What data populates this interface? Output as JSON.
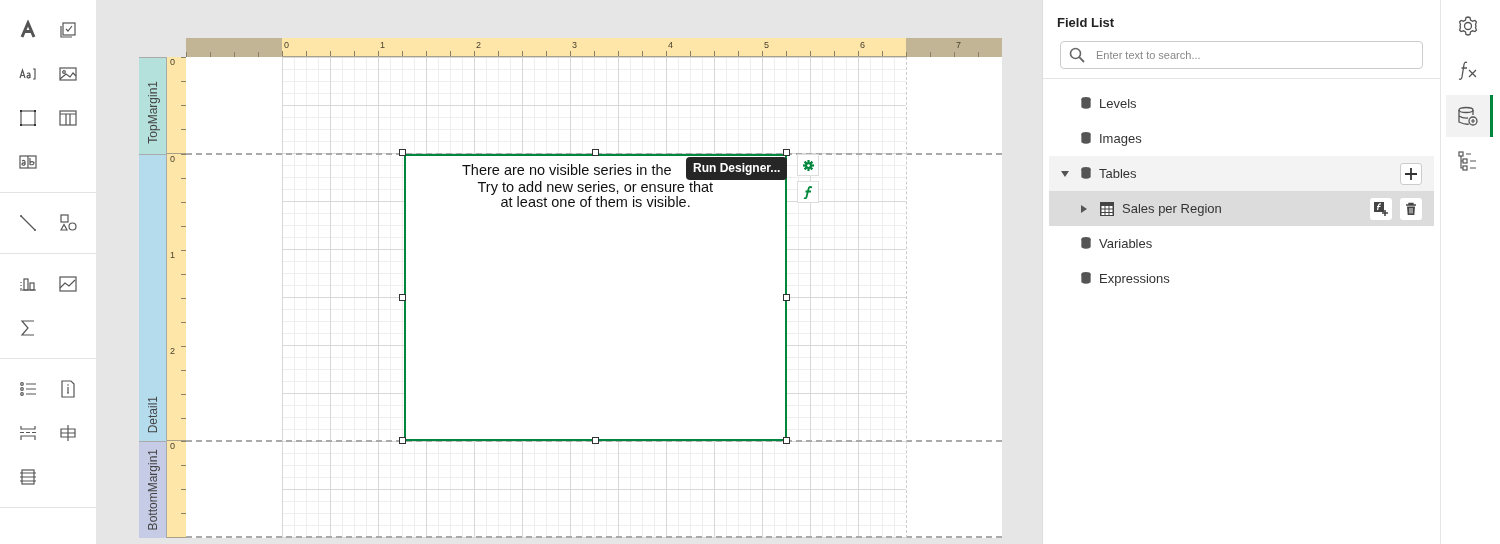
{
  "toolbox": {
    "groups": [
      {
        "tools": [
          {
            "kind": "label"
          },
          {
            "kind": "checkbox"
          },
          {
            "kind": "character-comb"
          },
          {
            "kind": "picture-box"
          },
          {
            "kind": "panel"
          },
          {
            "kind": "table"
          },
          {
            "kind": "rich-text"
          }
        ]
      },
      {
        "tools": [
          {
            "kind": "line"
          },
          {
            "kind": "shape"
          }
        ]
      },
      {
        "tools": [
          {
            "kind": "chart"
          },
          {
            "kind": "sparkline"
          },
          {
            "kind": "summary"
          }
        ]
      },
      {
        "tools": [
          {
            "kind": "list"
          },
          {
            "kind": "page-info"
          },
          {
            "kind": "page-break"
          },
          {
            "kind": "cross-band-line"
          },
          {
            "kind": "cross-band-box"
          }
        ]
      }
    ]
  },
  "ruler": {
    "labels": [
      "0",
      "1",
      "2",
      "3",
      "4",
      "5",
      "6",
      "7"
    ]
  },
  "bands": [
    {
      "name": "TopMargin1",
      "color": "#b5e1dc",
      "ruler_labels": [
        "0"
      ]
    },
    {
      "name": "Detail1",
      "color": "#b5dced",
      "ruler_labels": [
        "0",
        "1",
        "2"
      ]
    },
    {
      "name": "BottomMargin1",
      "color": "#c6cbe6",
      "ruler_labels": [
        "0"
      ]
    }
  ],
  "chart": {
    "selected": true,
    "message_lines": [
      "There are no visible series in the",
      "Try to add new series, or ensure that",
      "at least one of them is visible."
    ],
    "tooltip": "Run Designer..."
  },
  "field_list": {
    "title": "Field List",
    "search": {
      "placeholder": "Enter text to search..."
    },
    "items": [
      {
        "label": "Levels",
        "kind": "source",
        "selected": false,
        "hovered": false
      },
      {
        "label": "Images",
        "kind": "source",
        "selected": false,
        "hovered": false
      },
      {
        "label": "Tables",
        "kind": "source",
        "selected": false,
        "hovered": true,
        "expanded": true,
        "children": [
          {
            "label": "Sales per Region",
            "kind": "table",
            "selected": true,
            "hovered": false,
            "expanded": false
          }
        ]
      },
      {
        "label": "Variables",
        "kind": "source",
        "selected": false,
        "hovered": false
      },
      {
        "label": "Expressions",
        "kind": "source",
        "selected": false,
        "hovered": false
      }
    ]
  },
  "rail": {
    "items": [
      {
        "kind": "settings",
        "selected": false
      },
      {
        "kind": "functions",
        "selected": false
      },
      {
        "kind": "field-list",
        "selected": true
      },
      {
        "kind": "report-explorer",
        "selected": false
      }
    ]
  }
}
